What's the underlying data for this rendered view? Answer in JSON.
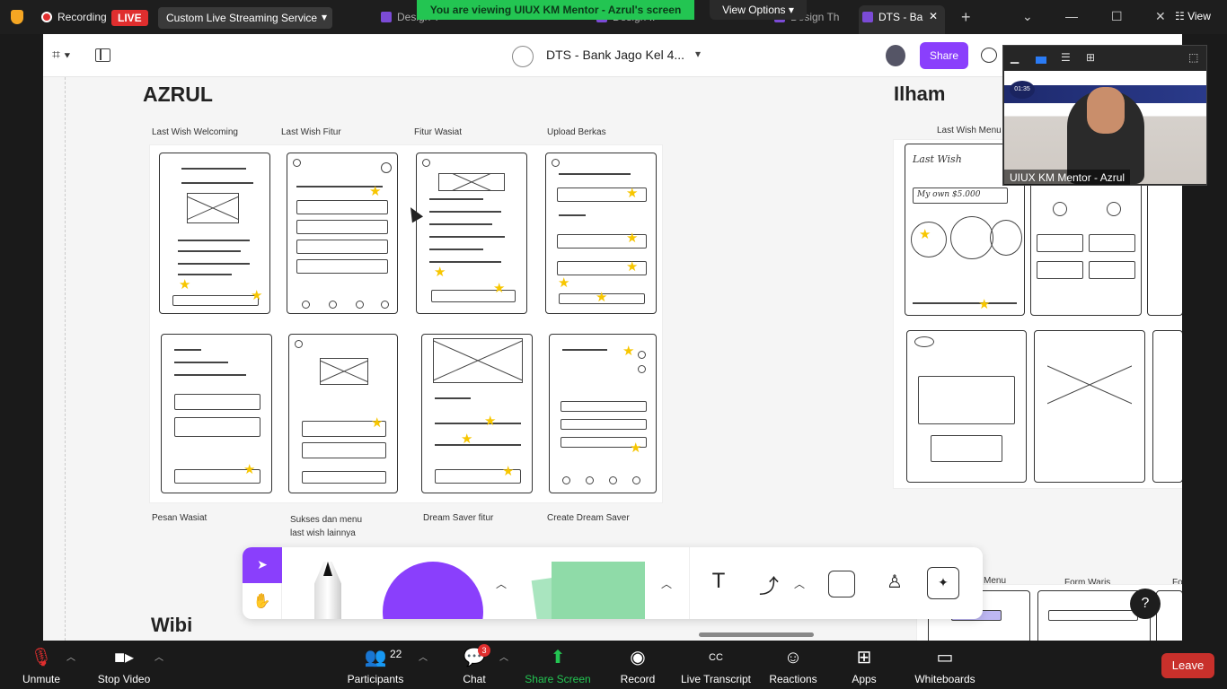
{
  "top_bar": {
    "recording_label": "Recording",
    "live_label": "LIVE",
    "stream_service": "Custom Live Streaming Service",
    "viewing_banner": "You are viewing UIUX KM Mentor - Azrul's screen",
    "view_options": "View Options",
    "view_label": "View",
    "tabs": [
      {
        "label": "Design T"
      },
      {
        "label": "Design ..."
      },
      {
        "label": "Design Th"
      },
      {
        "label": "DTS - Ba"
      }
    ]
  },
  "figma": {
    "file_title": "DTS - Bank Jago Kel 4...",
    "share_label": "Share"
  },
  "board": {
    "sections": [
      {
        "name": "AZRUL"
      },
      {
        "name": "Ilham"
      },
      {
        "name": "Wibi"
      }
    ],
    "azrul_top_labels": [
      "Last Wish Welcoming",
      "Last Wish Fitur",
      "Fitur Wasiat",
      "Upload Berkas"
    ],
    "azrul_bottom_labels": [
      "Pesan Wasiat",
      "Sukses dan menu last wish lainnya",
      "Dream Saver fitur",
      "Create Dream Saver"
    ],
    "ilham_label": "Last Wish Menu",
    "ilham_sketch_title": "Last Wish",
    "ilham_sketch_amount": "My own $5.000",
    "wibi_labels": [
      "Menu",
      "Form Waris",
      "Fo"
    ],
    "star_color": "#f7c600"
  },
  "video_tile": {
    "participant_name": "UIUX KM Mentor - Azrul",
    "timer": "01:35"
  },
  "help_label": "?",
  "zoom_controls": {
    "unmute": "Unmute",
    "stop_video": "Stop Video",
    "participants": "Participants",
    "participant_count": "22",
    "chat": "Chat",
    "chat_badge": "3",
    "share_screen": "Share Screen",
    "record": "Record",
    "live_transcript": "Live Transcript",
    "cc_label": "CC",
    "reactions": "Reactions",
    "apps": "Apps",
    "whiteboards": "Whiteboards",
    "leave": "Leave"
  },
  "colors": {
    "figma_accent": "#8a3ffc",
    "zoom_green": "#23c552",
    "leave_red": "#c8302b",
    "live_red": "#e02e2e"
  }
}
